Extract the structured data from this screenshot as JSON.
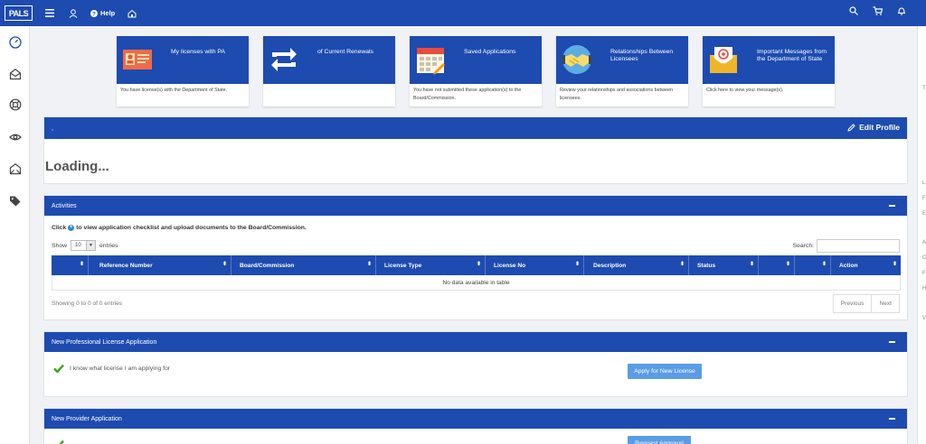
{
  "app": {
    "logo": "PALS"
  },
  "topbar": {
    "help_label": "Help"
  },
  "tiles": [
    {
      "title": "My licenses with PA",
      "description": "You have license(s) with the Department of State."
    },
    {
      "title": "of Current Renewals",
      "description": ""
    },
    {
      "title": "Saved Applications",
      "description": "You have not submitted these application(s) to the Board/Commission."
    },
    {
      "title": "Relationships Between Licensees",
      "description": "Review your relationships and associations between licensees."
    },
    {
      "title": "Important Messages from the Department of State",
      "description": "Click here to view your message(s)."
    }
  ],
  "profile": {
    "header": ",",
    "edit_label": "Edit Profile",
    "loading_text": "Loading..."
  },
  "activities": {
    "title": "Activities",
    "instruction_pre": "Click",
    "instruction_post": "to view application checklist and upload documents to the Board/Commission.",
    "show_label": "Show",
    "entries_value": "10",
    "entries_label": "entries",
    "search_label": "Search:",
    "columns": [
      "",
      "Reference Number",
      "Board/Commission",
      "License Type",
      "License No",
      "Description",
      "Status",
      "",
      "",
      "Action"
    ],
    "empty_text": "No data available in table",
    "showing_text": "Showing 0 to 0 of 0 entries",
    "previous_label": "Previous",
    "next_label": "Next"
  },
  "new_license": {
    "title": "New Professional License Application",
    "check_text": "I know what license I am applying for",
    "button_label": "Apply for New License"
  },
  "new_provider": {
    "title": "New Provider Application",
    "button_label": "Request Approval"
  },
  "right_pane": {
    "letters": [
      "T",
      "L",
      "F",
      "E",
      "A",
      "C",
      "F",
      "H",
      "V"
    ]
  },
  "colors": {
    "primary": "#1d4bb0",
    "button": "#5a9de6",
    "check": "#3aa31a",
    "plus": "#2e87d3"
  }
}
